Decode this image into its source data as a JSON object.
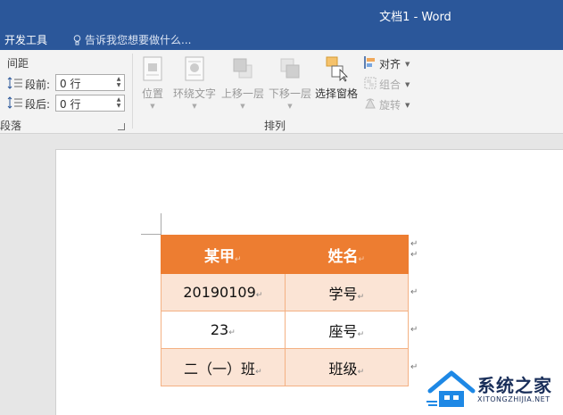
{
  "window": {
    "title": "文档1 - Word"
  },
  "tabs": {
    "developer": "开发工具",
    "tell_me": "告诉我您想要做什么..."
  },
  "paragraph": {
    "spacing_label": "间距",
    "before_label": "段前:",
    "before_value": "0 行",
    "after_label": "段后:",
    "after_value": "0 行",
    "group_label": "段落"
  },
  "arrange": {
    "position": "位置",
    "wrap_text": "环绕文字",
    "bring_forward": "上移一层",
    "send_backward": "下移一层",
    "selection_pane": "选择窗格",
    "align": "对齐",
    "group": "组合",
    "rotate": "旋转",
    "group_label": "排列"
  },
  "table": {
    "header": [
      "某甲",
      "姓名"
    ],
    "rows": [
      [
        "20190109",
        "学号"
      ],
      [
        "23",
        "座号"
      ],
      [
        "二（一）班",
        "班级"
      ]
    ],
    "paragraph_mark": "↵"
  },
  "watermark": {
    "name": "系统之家",
    "url": "XITONGZHIJIA.NET"
  },
  "colors": {
    "accent": "#2b579a",
    "table_header": "#ed7d31",
    "table_band": "#fbe4d5"
  }
}
